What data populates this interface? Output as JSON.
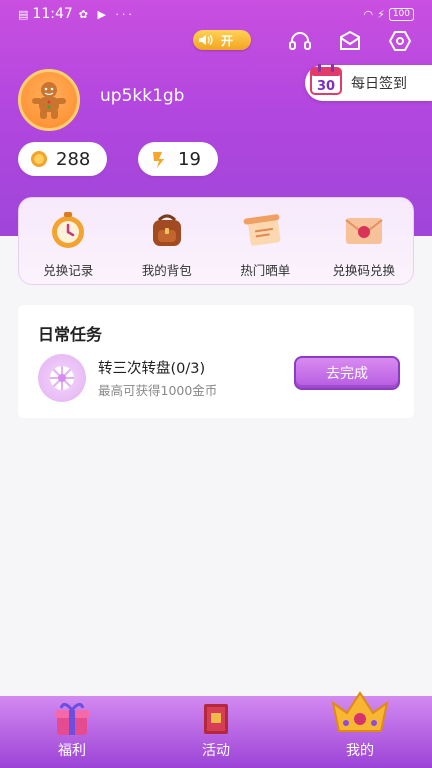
{
  "status_bar": {
    "time": "11:47",
    "battery": "100"
  },
  "sound_toggle": {
    "label": "开"
  },
  "profile": {
    "username": "up5kk1gb"
  },
  "signin": {
    "day": "30",
    "label": "每日签到"
  },
  "balances": {
    "coins": "288",
    "vouchers": "19"
  },
  "quick_actions": [
    {
      "label": "兑换记录",
      "icon": "stopwatch-icon"
    },
    {
      "label": "我的背包",
      "icon": "backpack-icon"
    },
    {
      "label": "热门晒单",
      "icon": "scroll-icon"
    },
    {
      "label": "兑换码兑换",
      "icon": "envelope-icon"
    }
  ],
  "daily_tasks": {
    "title": "日常任务",
    "task": {
      "name": "转三次转盘(0/3)",
      "desc": "最高可获得1000金币",
      "button": "去完成"
    }
  },
  "tabbar": [
    {
      "label": "福利",
      "icon": "gift-icon"
    },
    {
      "label": "活动",
      "icon": "book-icon"
    },
    {
      "label": "我的",
      "icon": "crown-icon",
      "active": true
    }
  ],
  "colors": {
    "accent": "#b347df",
    "gold": "#f4a41f"
  }
}
